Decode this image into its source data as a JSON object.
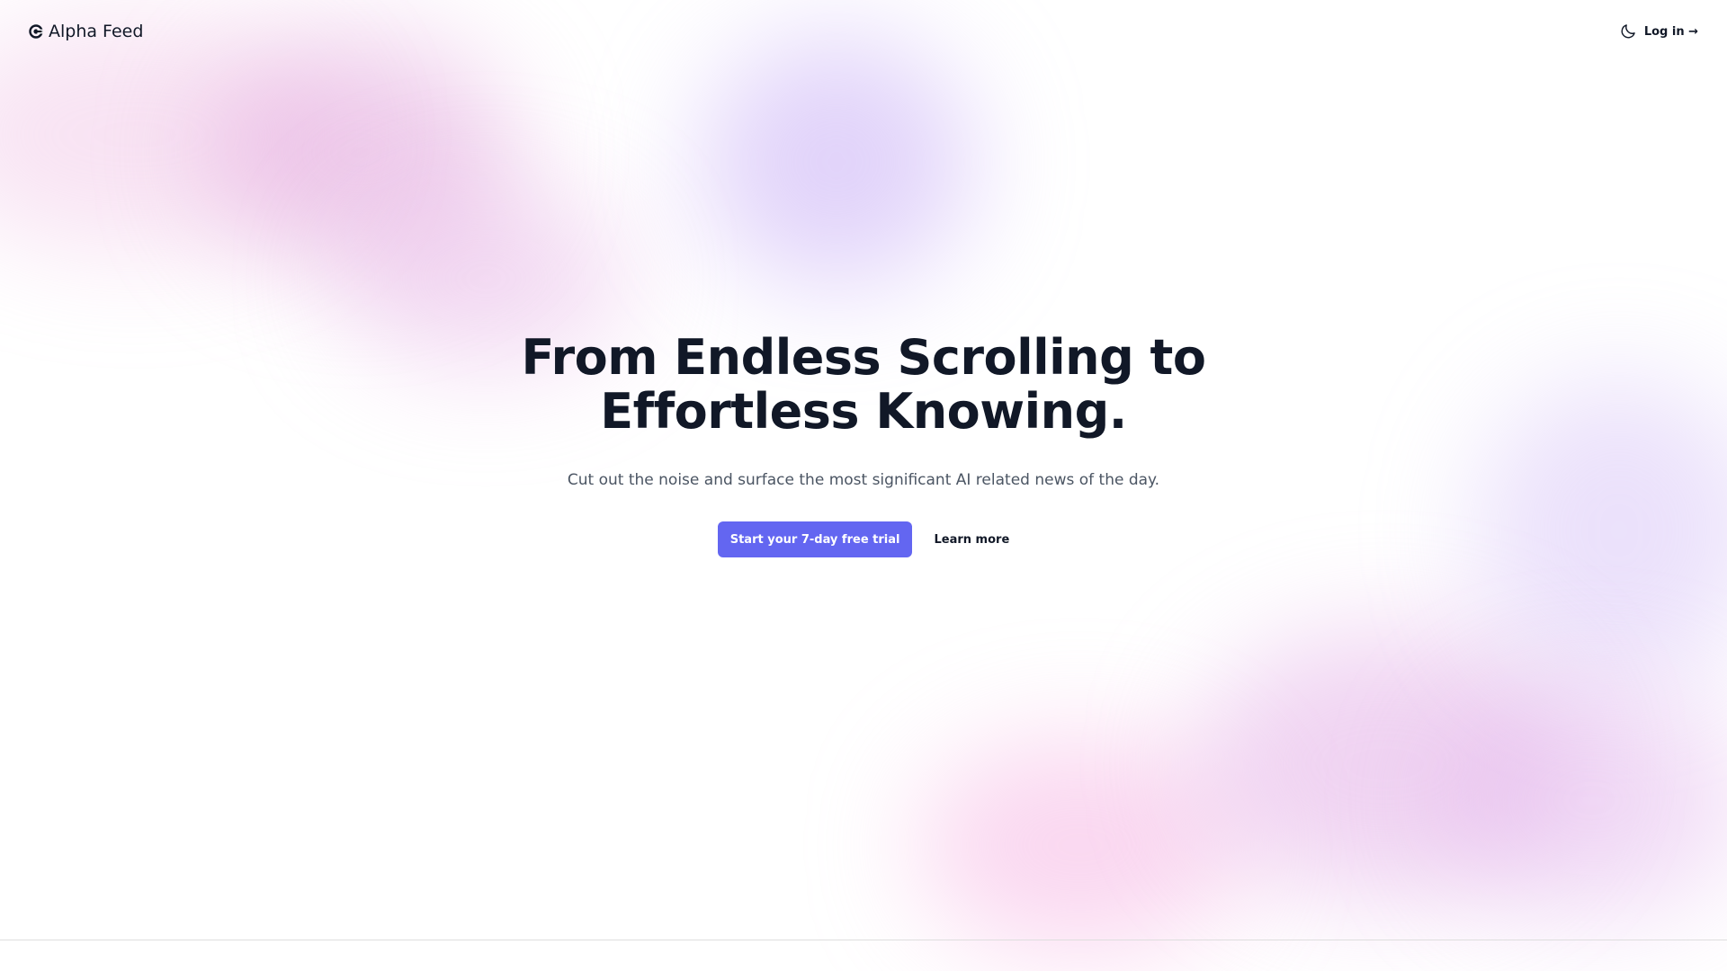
{
  "header": {
    "logo_text": "Alpha Feed",
    "logo_icon": "alpha-feed-logo-icon",
    "theme_toggle_icon": "moon-icon",
    "login_label": "Log in →"
  },
  "hero": {
    "headline_line1": "From Endless Scrolling to",
    "headline_line2": "Effortless Knowing.",
    "subtitle": "Cut out the noise and surface the most significant AI related news of the day.",
    "primary_cta": "Start your 7-day free trial",
    "secondary_cta": "Learn more"
  },
  "colors": {
    "accent": "#6366f1",
    "text": "#111827",
    "muted_text": "#4b5563",
    "background": "#ffffff"
  }
}
